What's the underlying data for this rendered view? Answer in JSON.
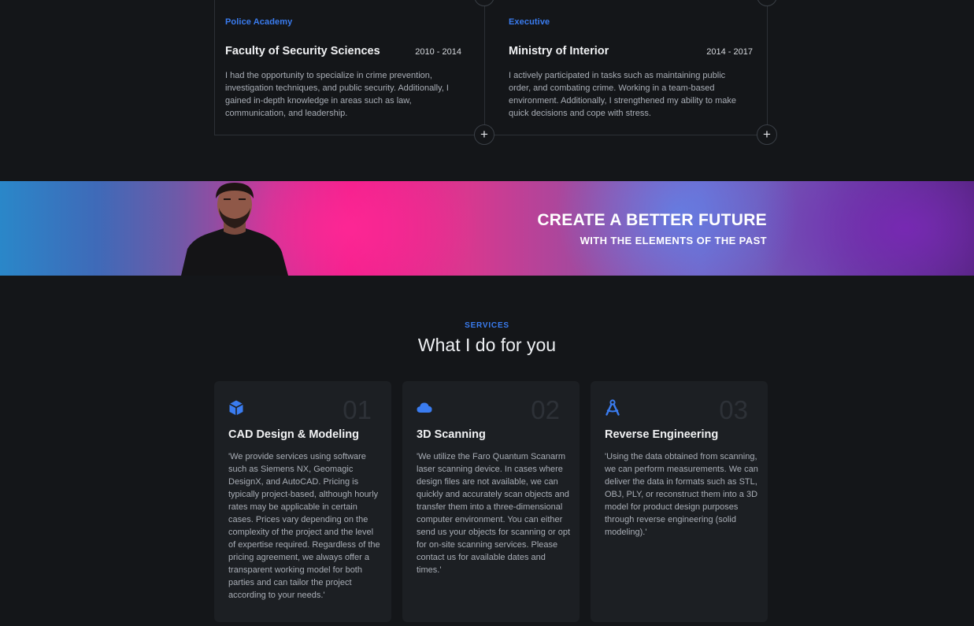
{
  "timeline": {
    "items": [
      {
        "kicker": "Police Academy",
        "title": "Faculty of Security Sciences",
        "years": "2010 - 2014",
        "description": "I had the opportunity to specialize in crime prevention, investigation techniques, and public security. Additionally, I gained in-depth knowledge in areas such as law, communication, and leadership."
      },
      {
        "kicker": "Executive",
        "title": "Ministry of Interior",
        "years": "2014 - 2017",
        "description": "I actively participated in tasks such as maintaining public order, and combating crime. Working in a team-based environment. Additionally, I strengthened my ability to make quick decisions and cope with stress."
      }
    ],
    "expand_icon": "plus-icon"
  },
  "banner": {
    "title": "CREATE A BETTER FUTURE",
    "subtitle": "WITH THE ELEMENTS OF THE PAST"
  },
  "services": {
    "kicker": "SERVICES",
    "heading": "What I do for you",
    "cards": [
      {
        "icon": "cube-icon",
        "number": "01",
        "title": "CAD Design & Modeling",
        "description": "'We provide services using software such as Siemens NX, Geomagic DesignX, and AutoCAD. Pricing is typically project-based, although hourly rates may be applicable in certain cases. Prices vary depending on the complexity of the project and the level of expertise required. Regardless of the pricing agreement, we always offer a transparent working model for both parties and can tailor the project according to your needs.'"
      },
      {
        "icon": "cloud-icon",
        "number": "02",
        "title": "3D Scanning",
        "description": "'We utilize the Faro Quantum Scanarm laser scanning device. In cases where design files are not available, we can quickly and accurately scan objects and transfer them into a three-dimensional computer environment. You can either send us your objects for scanning or opt for on-site scanning services. Please contact us for available dates and times.'"
      },
      {
        "icon": "compass-drafting-icon",
        "number": "03",
        "title": "Reverse Engineering",
        "description": "'Using the data obtained from scanning, we can perform measurements. We can deliver the data in formats such as STL, OBJ, PLY, or reconstruct them into a 3D model for product design purposes through reverse engineering (solid modeling).'"
      }
    ]
  },
  "colors": {
    "background": "#141619",
    "card": "#1c1f23",
    "accent": "#3a7cf0",
    "text": "#f1f2f4",
    "muted": "#a9aeb6"
  }
}
